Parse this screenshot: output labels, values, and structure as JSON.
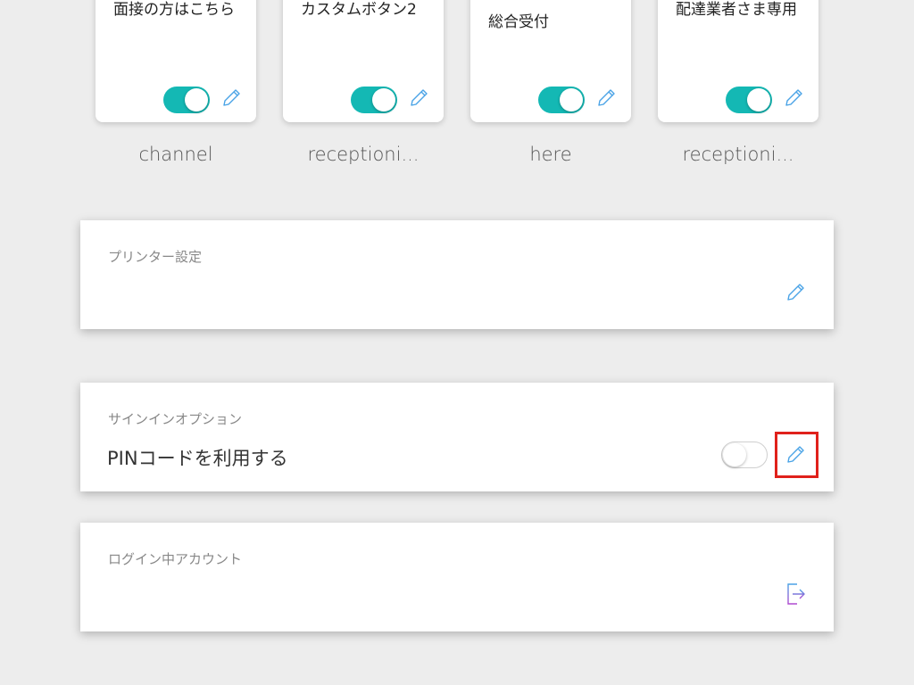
{
  "buttons": [
    {
      "label": "面接の方はこちら",
      "channel": "channel",
      "enabled": true
    },
    {
      "label": "カスタムボタン2",
      "channel": "receptioni...",
      "enabled": true
    },
    {
      "label": "総合受付",
      "channel": "here",
      "enabled": true
    },
    {
      "label": "配達業者さま専用",
      "channel": "receptioni...",
      "enabled": true
    }
  ],
  "printer": {
    "title": "プリンター設定"
  },
  "signin": {
    "title": "サインインオプション",
    "pin_label": "PINコードを利用する",
    "pin_enabled": false
  },
  "account": {
    "title": "ログイン中アカウント"
  },
  "colors": {
    "accent": "#14b8b4",
    "icon": "#4aa3e6",
    "highlight": "#e0211b"
  },
  "icons": {
    "edit": "pencil-icon",
    "logout": "logout-icon"
  }
}
